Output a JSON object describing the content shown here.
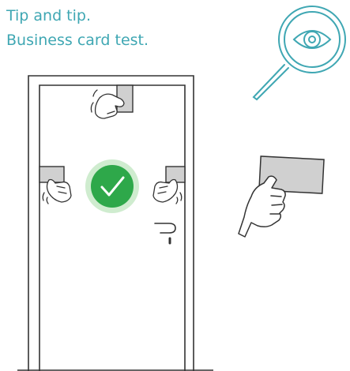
{
  "title": {
    "line1": "Tip and tip.",
    "line2": "Business card test."
  },
  "colors": {
    "accent": "#3fa7b3",
    "ok": "#2ea84a",
    "ok_halo": "#cfeccf",
    "card": "#d0d0d0",
    "line": "#333333"
  },
  "icons": {
    "magnifier": "magnifier-eye-icon",
    "check": "check-icon"
  }
}
